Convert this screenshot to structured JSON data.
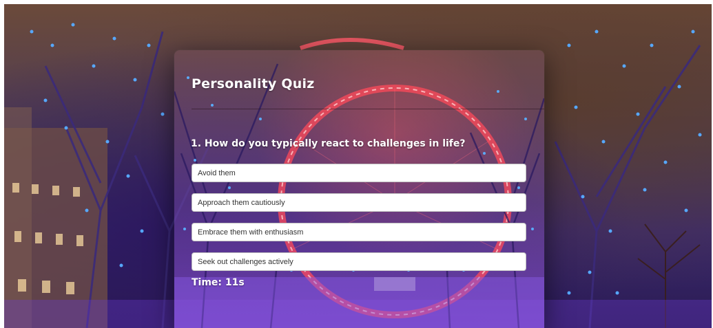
{
  "quiz": {
    "title": "Personality Quiz",
    "question": "1. How do you typically react to challenges in life?",
    "options": [
      "Avoid them",
      "Approach them cautiously",
      "Embrace them with enthusiasm",
      "Seek out challenges actively"
    ],
    "timer": "Time: 11s"
  },
  "theme": {
    "accent_red": "#ff4a5a",
    "tree_blue": "#3f7bff",
    "option_bg": "#ffffff"
  }
}
